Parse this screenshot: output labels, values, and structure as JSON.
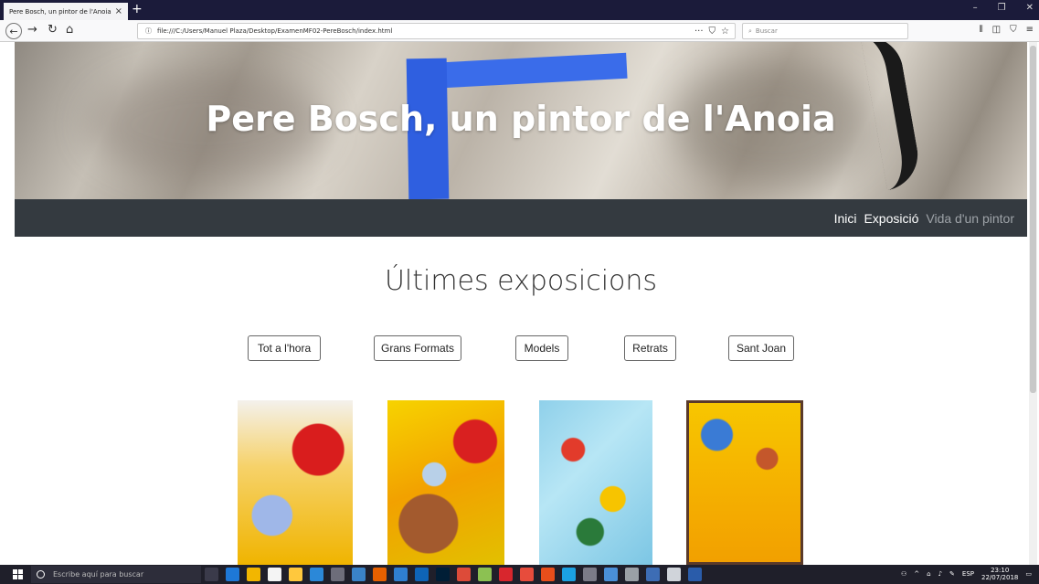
{
  "browser": {
    "tab_title": "Pere Bosch, un pintor de l'Anoia",
    "tab_close": "×",
    "new_tab": "+",
    "url": "file:///C:/Users/Manuel Plaza/Desktop/ExamenMF02-PereBosch/index.html",
    "search_placeholder": "Buscar",
    "url_menu": "···"
  },
  "site": {
    "hero_title": "Pere Bosch, un pintor de l'Anoia",
    "nav": [
      {
        "label": "Inici"
      },
      {
        "label": "Exposició"
      },
      {
        "label": "Vida d'un pintor"
      }
    ],
    "section_title": "Últimes exposicions",
    "filters": [
      {
        "label": "Tot a l'hora"
      },
      {
        "label": "Grans Formats"
      },
      {
        "label": "Models"
      },
      {
        "label": "Retrats"
      },
      {
        "label": "Sant Joan"
      }
    ]
  },
  "taskbar": {
    "search_placeholder": "Escribe aquí para buscar",
    "lang": "ESP",
    "time": "23:10",
    "date": "22/07/2018"
  },
  "colors": {
    "nav_bg": "#343a40",
    "hero_blue": "#2f5fe0",
    "taskbar_bg": "#1f1f2a"
  }
}
